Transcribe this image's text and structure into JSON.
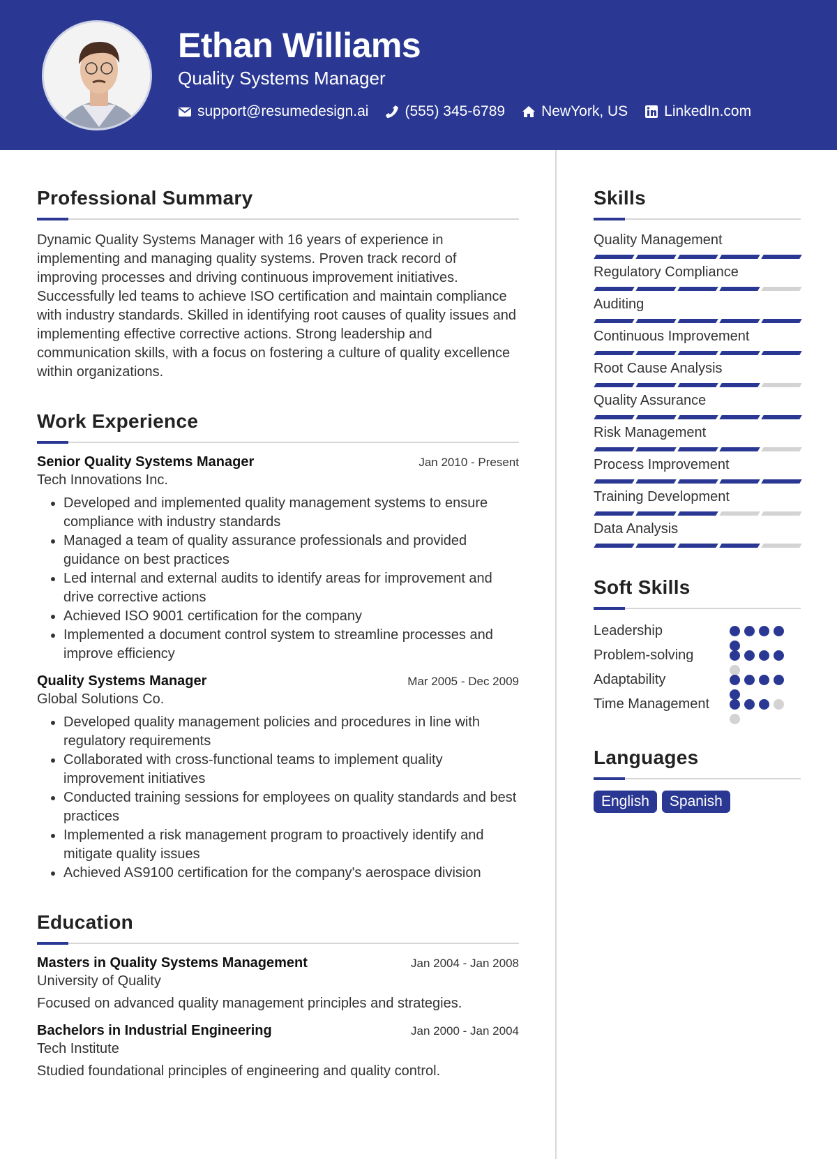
{
  "header": {
    "name": "Ethan Williams",
    "title": "Quality Systems Manager",
    "contacts": [
      {
        "icon": "envelope-icon",
        "text": "support@resumedesign.ai"
      },
      {
        "icon": "phone-icon",
        "text": "(555) 345-6789"
      },
      {
        "icon": "home-icon",
        "text": "NewYork, US"
      },
      {
        "icon": "linkedin-icon",
        "text": "LinkedIn.com"
      }
    ]
  },
  "summary": {
    "title": "Professional Summary",
    "text": "Dynamic Quality Systems Manager with 16 years of experience in implementing and managing quality systems. Proven track record of improving processes and driving continuous improvement initiatives. Successfully led teams to achieve ISO certification and maintain compliance with industry standards. Skilled in identifying root causes of quality issues and implementing effective corrective actions. Strong leadership and communication skills, with a focus on fostering a culture of quality excellence within organizations."
  },
  "experience": {
    "title": "Work Experience",
    "jobs": [
      {
        "role": "Senior Quality Systems Manager",
        "date": "Jan 2010 - Present",
        "company": "Tech Innovations Inc.",
        "bullets": [
          "Developed and implemented quality management systems to ensure compliance with industry standards",
          "Managed a team of quality assurance professionals and provided guidance on best practices",
          "Led internal and external audits to identify areas for improvement and drive corrective actions",
          "Achieved ISO 9001 certification for the company",
          "Implemented a document control system to streamline processes and improve efficiency"
        ]
      },
      {
        "role": "Quality Systems Manager",
        "date": "Mar 2005 - Dec 2009",
        "company": "Global Solutions Co.",
        "bullets": [
          "Developed quality management policies and procedures in line with regulatory requirements",
          "Collaborated with cross-functional teams to implement quality improvement initiatives",
          "Conducted training sessions for employees on quality standards and best practices",
          "Implemented a risk management program to proactively identify and mitigate quality issues",
          "Achieved AS9100 certification for the company's aerospace division"
        ]
      }
    ]
  },
  "education": {
    "title": "Education",
    "items": [
      {
        "degree": "Masters in Quality Systems Management",
        "date": "Jan 2004 - Jan 2008",
        "school": "University of Quality",
        "desc": "Focused on advanced quality management principles and strategies."
      },
      {
        "degree": "Bachelors in Industrial Engineering",
        "date": "Jan 2000 - Jan 2004",
        "school": "Tech Institute",
        "desc": "Studied foundational principles of engineering and quality control."
      }
    ]
  },
  "skills": {
    "title": "Skills",
    "max": 5,
    "items": [
      {
        "name": "Quality Management",
        "level": 5
      },
      {
        "name": "Regulatory Compliance",
        "level": 4
      },
      {
        "name": "Auditing",
        "level": 5
      },
      {
        "name": "Continuous Improvement",
        "level": 5
      },
      {
        "name": "Root Cause Analysis",
        "level": 4
      },
      {
        "name": "Quality Assurance",
        "level": 5
      },
      {
        "name": "Risk Management",
        "level": 4
      },
      {
        "name": "Process Improvement",
        "level": 5
      },
      {
        "name": "Training Development",
        "level": 3
      },
      {
        "name": "Data Analysis",
        "level": 4
      }
    ]
  },
  "soft_skills": {
    "title": "Soft Skills",
    "max": 5,
    "items": [
      {
        "name": "Leadership",
        "level": 5
      },
      {
        "name": "Problem-solving",
        "level": 4
      },
      {
        "name": "Adaptability",
        "level": 5
      },
      {
        "name": "Time Management",
        "level": 3
      }
    ]
  },
  "languages": {
    "title": "Languages",
    "items": [
      "English",
      "Spanish"
    ]
  },
  "colors": {
    "accent": "#2a3893",
    "inactive": "#d3d3d3"
  }
}
